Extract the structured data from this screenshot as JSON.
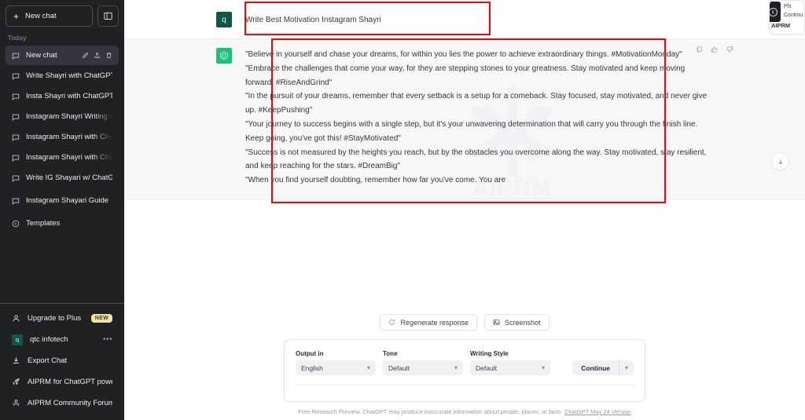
{
  "sidebar": {
    "new_chat_label": "New chat",
    "collapse_icon": "sidebar-toggle-icon",
    "section_label": "Today",
    "chats": [
      {
        "label": "New chat",
        "active": true
      },
      {
        "label": "Write Shayri with ChatGPT",
        "active": false
      },
      {
        "label": "Insta Shayri with ChatGPT",
        "active": false
      },
      {
        "label": "Instagram Shayri Writing Guide",
        "active": false
      },
      {
        "label": "Instagram Shayri with ChatGPT",
        "active": false
      },
      {
        "label": "Instagram Shayri with Chatgpt",
        "active": false
      },
      {
        "label": "Write IG Shayari w/ ChatGPT",
        "active": false
      },
      {
        "label": "Instagram Shayari Guide",
        "active": false
      },
      {
        "label": "Templates",
        "active": false
      }
    ],
    "row_actions": [
      "edit-icon",
      "share-icon",
      "delete-icon"
    ],
    "bottom_items": [
      {
        "label": "Upgrade to Plus",
        "icon": "person-icon",
        "badge": "NEW"
      },
      {
        "label": "qtc infotech",
        "icon": "account-avatar",
        "avatar_text": "q",
        "trailing": "•••"
      },
      {
        "label": "Export Chat",
        "icon": "download-icon"
      },
      {
        "label": "AIPRM for ChatGPT powered",
        "icon": "rocket-icon"
      },
      {
        "label": "AIPRM Community Forum",
        "icon": "community-icon"
      }
    ]
  },
  "conversation": {
    "user_avatar_text": "q",
    "user_message": "Write Best Motivation Instagram Shayri",
    "assistant_lines": [
      "\"Believe in yourself and chase your dreams, for within you lies the power to achieve extraordinary things. #MotivationMonday\"",
      "\"Embrace the challenges that come your way, for they are stepping stones to your greatness. Stay motivated and keep moving forward. #RiseAndGrind\"",
      "\"In the pursuit of your dreams, remember that every setback is a setup for a comeback. Stay focused, stay motivated, and never give up. #KeepPushing\"",
      "\"Your journey to success begins with a single step, but it's your unwavering determination that will carry you through the finish line. Keep going, you've got this! #StayMotivated\"",
      "\"Success is not measured by the heights you reach, but by the obstacles you overcome along the way. Stay motivated, stay resilient, and keep reaching for the stars. #DreamBig\"",
      "\"When you find yourself doubting, remember how far you've come. You are"
    ],
    "message_actions": [
      "copy-icon",
      "thumbs-up-icon",
      "thumbs-down-icon"
    ],
    "watermark_text": "AIPRM",
    "scroll_button_icon": "arrow-down-icon"
  },
  "widget": {
    "icon_letter": "K",
    "line1": "Pls",
    "line2": "Continu",
    "brand": "AIPRM"
  },
  "toolbar": {
    "regenerate_label": "Regenerate response",
    "regenerate_icon": "refresh-icon",
    "screenshot_label": "Screenshot",
    "screenshot_icon": "image-icon"
  },
  "aiprm_panel": {
    "fields": [
      {
        "label": "Output in",
        "value": "English"
      },
      {
        "label": "Tone",
        "value": "Default"
      },
      {
        "label": "Writing Style",
        "value": "Default"
      }
    ],
    "continue_label": "Continue",
    "caret_icon": "chevron-down-icon"
  },
  "footer": {
    "note": "Free Research Preview. ChatGPT may produce inaccurate information about people, places, or facts.",
    "link": "ChatGPT May 24 Version"
  },
  "colors": {
    "sidebar_bg": "#202123",
    "active_chat": "#343541",
    "assistant_bg": "#f7f7f8",
    "brand_green": "#19c37d",
    "user_avatar": "#10564a",
    "highlight": "#ff0000",
    "badge_new": "#f2e2a8"
  }
}
